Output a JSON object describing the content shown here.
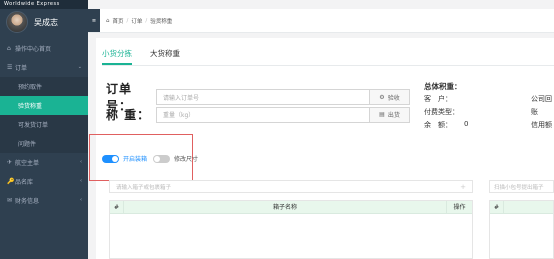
{
  "brand": "Worldwide Express",
  "user": {
    "name": "吴成志"
  },
  "sidebar": {
    "items": [
      {
        "icon": "⌂",
        "label": "操作中心首页"
      },
      {
        "icon": "☰",
        "label": "订单",
        "chev": "⌄"
      }
    ],
    "order_sub": [
      "预约取件",
      "验货称重",
      "可发货订单",
      "问题件"
    ],
    "items_after": [
      {
        "icon": "✈",
        "label": "航空主单",
        "chev": "‹"
      },
      {
        "icon": "🔑",
        "label": "品名库",
        "chev": "‹"
      },
      {
        "icon": "✉",
        "label": "财务信息",
        "chev": "‹"
      }
    ]
  },
  "topbar": {
    "toggle_icon": "≡",
    "breadcrumb": [
      "首页",
      "订单",
      "验货称重"
    ],
    "home_icon": "⌂",
    "sep": "/"
  },
  "tabs": [
    "小货分拣",
    "大货称重"
  ],
  "form": {
    "order_label": "订单号：",
    "order_placeholder": "请输入订单号",
    "order_btn": "验收",
    "weight_label": "称 重：",
    "weight_placeholder": "重量（kg）",
    "weight_btn": "出货"
  },
  "summary": {
    "title": "总体积重：",
    "rows": [
      {
        "label": "客　户：",
        "value": "",
        "right": "公司回"
      },
      {
        "label": "付费类型：",
        "value": "",
        "right": "账　"
      },
      {
        "label": "余　额：",
        "value": "0",
        "right": "信用额"
      }
    ]
  },
  "toggles": [
    {
      "label": "开启装箱",
      "state": "on"
    },
    {
      "label": "修改尺寸",
      "state": "off"
    }
  ],
  "search_left": {
    "placeholder": "请输入箱子或包裹箱子",
    "plus": "+"
  },
  "search_right": {
    "placeholder": "扫描小包号提出箱子"
  },
  "table_left": {
    "idx": "#",
    "name": "箱子名称",
    "action": "操作"
  },
  "table_right": {
    "idx": "#"
  }
}
